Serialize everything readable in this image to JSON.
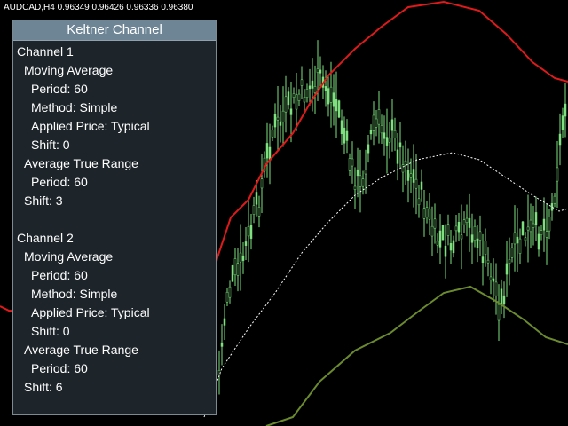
{
  "symbol_info": "AUDCAD,H4  0.96349 0.96426 0.96336 0.96380",
  "colors": {
    "background": "#000000",
    "candles": "#7ee07e",
    "upper_band": "#e01a1a",
    "middle_line": "#ffffff",
    "lower_band": "#6b8a2e",
    "panel_bg": "#1d252b",
    "panel_header": "#6e8596"
  },
  "panel": {
    "title": "Keltner Channel",
    "channel1": {
      "title": "Channel 1",
      "ma_title": "Moving Average",
      "ma_period": "Period: 60",
      "ma_method": "Method: Simple",
      "ma_price": "Applied Price: Typical",
      "ma_shift": "Shift: 0",
      "atr_title": "Average True Range",
      "atr_period": "Period: 60",
      "shift": "Shift: 3"
    },
    "channel2": {
      "title": "Channel 2",
      "ma_title": "Moving Average",
      "ma_period": "Period: 60",
      "ma_method": "Method: Simple",
      "ma_price": "Applied Price: Typical",
      "ma_shift": "Shift: 0",
      "atr_title": "Average True Range",
      "atr_period": "Period: 60",
      "shift": "Shift: 6"
    }
  }
}
